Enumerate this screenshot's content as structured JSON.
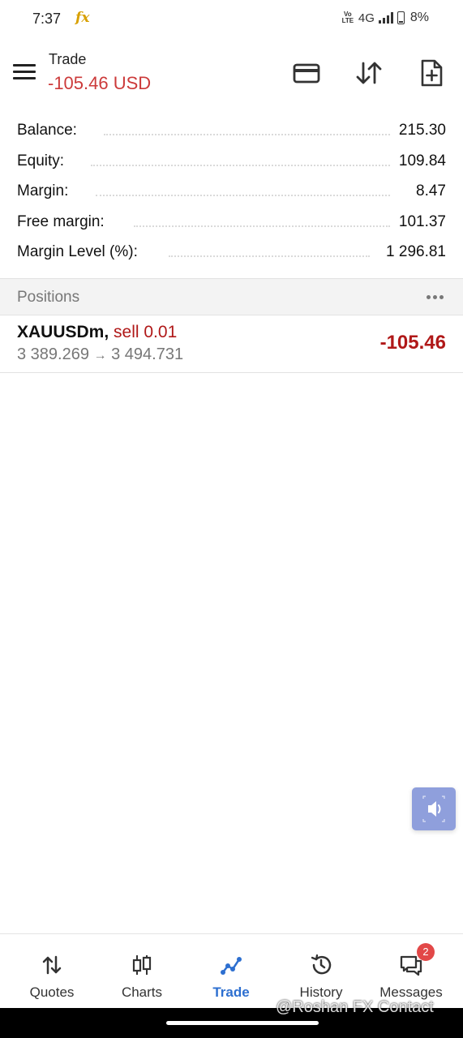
{
  "status_bar": {
    "time": "7:37",
    "app_icon": "fx",
    "volte": "Vo",
    "lte": "LTE",
    "network": "4G",
    "battery": "8%"
  },
  "header": {
    "title": "Trade",
    "profit_value": "-105.46 USD",
    "icons": [
      "menu-icon",
      "deposit-card-icon",
      "sort-icon",
      "new-order-icon"
    ]
  },
  "account": {
    "balance_label": "Balance:",
    "balance_value": "215.30",
    "equity_label": "Equity:",
    "equity_value": "109.84",
    "margin_label": "Margin:",
    "margin_value": "8.47",
    "free_margin_label": "Free margin:",
    "free_margin_value": "101.37",
    "margin_level_label": "Margin Level (%):",
    "margin_level_value": "1 296.81"
  },
  "positions": {
    "section_title": "Positions",
    "items": [
      {
        "symbol": "XAUUSDm,",
        "side": "sell 0.01",
        "open_price": "3 389.269",
        "arrow": "→",
        "current_price": "3 494.731",
        "profit": "-105.46"
      }
    ]
  },
  "bottom_nav": {
    "items": [
      {
        "label": "Quotes",
        "icon": "quotes-arrows-icon",
        "active": false
      },
      {
        "label": "Charts",
        "icon": "candlestick-icon",
        "active": false
      },
      {
        "label": "Trade",
        "icon": "trade-line-icon",
        "active": true
      },
      {
        "label": "History",
        "icon": "history-clock-icon",
        "active": false
      },
      {
        "label": "Messages",
        "icon": "messages-icon",
        "active": false,
        "badge": "2"
      }
    ]
  },
  "watermark": "@Roshan FX Contact",
  "colors": {
    "negative": "#b01818",
    "header_loss": "#cc3a3a",
    "active_tab": "#2d6fd0",
    "badge": "#e24848"
  }
}
